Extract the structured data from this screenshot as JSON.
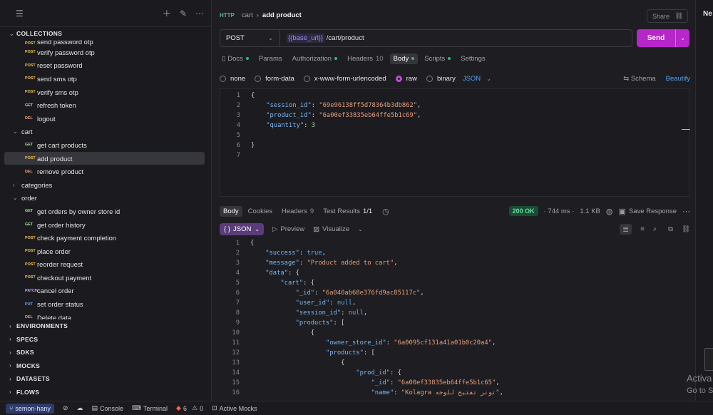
{
  "sidebar": {
    "collections_label": "COLLECTIONS",
    "partial_top_label": "send password otp",
    "items": [
      {
        "method": "POST",
        "label": "verify password otp"
      },
      {
        "method": "POST",
        "label": "reset password"
      },
      {
        "method": "POST",
        "label": "send sms otp"
      },
      {
        "method": "POST",
        "label": "verify sms otp"
      },
      {
        "method": "GET",
        "label": "refresh token"
      },
      {
        "method": "DEL",
        "label": "logout"
      }
    ],
    "folder_cart": "cart",
    "cart_items": [
      {
        "method": "GET",
        "label": "get cart products"
      },
      {
        "method": "POST",
        "label": "add product"
      },
      {
        "method": "DEL",
        "label": "remove product"
      }
    ],
    "folder_categories": "categories",
    "folder_order": "order",
    "order_items": [
      {
        "method": "GET",
        "label": "get orders by owner store id"
      },
      {
        "method": "GET",
        "label": "get order history"
      },
      {
        "method": "POST",
        "label": "check payment completion"
      },
      {
        "method": "POST",
        "label": "place order"
      },
      {
        "method": "POST",
        "label": "reorder request"
      },
      {
        "method": "POST",
        "label": "checkout payment"
      },
      {
        "method": "PATCH",
        "label": "cancel order"
      },
      {
        "method": "PUT",
        "label": "set order status"
      },
      {
        "method": "DEL",
        "label": "Delete data"
      }
    ],
    "sections": [
      "ENVIRONMENTS",
      "SPECS",
      "SDKS",
      "MOCKS",
      "DATASETS",
      "FLOWS"
    ]
  },
  "request": {
    "http_badge": "HTTP",
    "crumb_parent": "cart",
    "crumb_current": "add product",
    "share_label": "Share",
    "method": "POST",
    "url_var": "{{base_url}}",
    "url_path": "/cart/product",
    "send_label": "Send",
    "tabs": [
      {
        "label": "Docs",
        "count": "",
        "dot": true
      },
      {
        "label": "Params",
        "count": "",
        "dot": false
      },
      {
        "label": "Authorization",
        "count": "",
        "dot": true
      },
      {
        "label": "Headers",
        "count": "10",
        "dot": false
      },
      {
        "label": "Body",
        "count": "",
        "dot": true
      },
      {
        "label": "Scripts",
        "count": "",
        "dot": true
      },
      {
        "label": "Settings",
        "count": "",
        "dot": false
      }
    ],
    "body_modes": [
      "none",
      "form-data",
      "x-www-form-urlencoded",
      "raw",
      "binary"
    ],
    "body_lang": "JSON",
    "schema_label": "Schema",
    "beautify_label": "Beautify",
    "body_lines": [
      "{",
      "    \"session_id\": \"69e96138ff5d78364b3db862\",",
      "    \"product_id\": \"6a00ef33835eb64ffe5b1c69\",",
      "    \"quantity\": 3",
      "",
      "}",
      ""
    ]
  },
  "response": {
    "tabs": [
      {
        "label": "Body",
        "count": ""
      },
      {
        "label": "Cookies",
        "count": ""
      },
      {
        "label": "Headers",
        "count": "9"
      },
      {
        "label": "Test Results",
        "count": "1/1"
      }
    ],
    "status": "200 OK",
    "time": "744 ms",
    "size": "1.1 KB",
    "save_label": "Save Response",
    "format_label": "JSON",
    "preview_label": "Preview",
    "visualize_label": "Visualize",
    "lines": [
      "{",
      "    \"success\": true,",
      "    \"message\": \"Product added to cart\",",
      "    \"data\": {",
      "        \"cart\": {",
      "            \"_id\": \"6a040ab68e376fd9ac85117c\",",
      "            \"user_id\": null,",
      "            \"session_id\": null,",
      "            \"products\": [",
      "                {",
      "                    \"owner_store_id\": \"6a0095cf131a41a01b0c20a4\",",
      "                    \"products\": [",
      "                        {",
      "                            \"prod_id\": {",
      "                                \"_id\": \"6a00ef33835eb64ffe5b1c65\",",
      "                                \"name\": \"Kolagra تونر تفتيح للوجه\","
    ]
  },
  "statusbar": {
    "branch": "semon-hany",
    "console": "Console",
    "terminal": "Terminal",
    "errors": "6",
    "warnings": "0",
    "mocks": "Active Mocks"
  },
  "right_strip": {
    "label": "Ne"
  },
  "watermark": {
    "line1": "Activa",
    "line2": "Go to S"
  }
}
